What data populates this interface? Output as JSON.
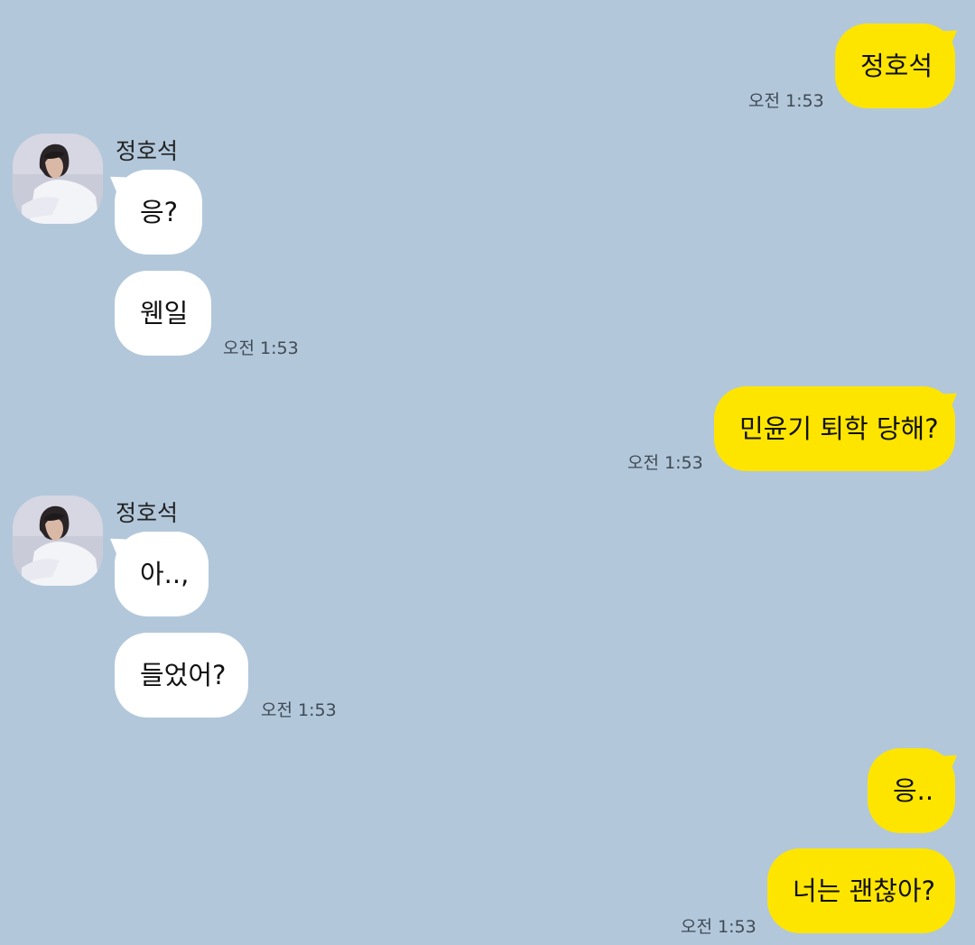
{
  "messages": [
    {
      "from": "me",
      "text": "정호석",
      "time": "오전 1:53"
    },
    {
      "from": "them",
      "sender": "정호석",
      "text": "응?"
    },
    {
      "from": "them",
      "text": "웬일",
      "time": "오전 1:53"
    },
    {
      "from": "me",
      "text": "민윤기 퇴학 당해?",
      "time": "오전 1:53"
    },
    {
      "from": "them",
      "sender": "정호석",
      "text": "아..,"
    },
    {
      "from": "them",
      "text": "들었어?",
      "time": "오전 1:53"
    },
    {
      "from": "me",
      "text": "응.."
    },
    {
      "from": "me",
      "text": "너는 괜찮아?",
      "time": "오전 1:53"
    }
  ],
  "colors": {
    "background": "#B2C7DA",
    "my_bubble": "#FEE500",
    "their_bubble": "#FFFFFF"
  }
}
